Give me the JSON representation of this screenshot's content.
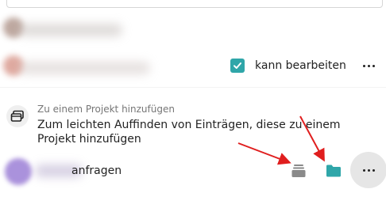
{
  "share_list": {
    "second_share": {
      "permission_label": "kann bearbeiten",
      "permission_checked": true
    }
  },
  "project": {
    "subtitle": "Zu einem Projekt hinzufügen",
    "description": "Zum leichten Auffinden von Einträgen, diese zu einem Projekt hinzufügen"
  },
  "request_row": {
    "label_suffix": "anfragen"
  },
  "colors": {
    "accent": "#2fa6a9",
    "arrow": "#e01e1e",
    "muted_icon": "#8a8a8a"
  },
  "icons": {
    "checkbox": "check-icon",
    "project": "project-icon",
    "archive": "archive-icon",
    "folder": "folder-icon",
    "more": "more-horizontal-icon"
  }
}
